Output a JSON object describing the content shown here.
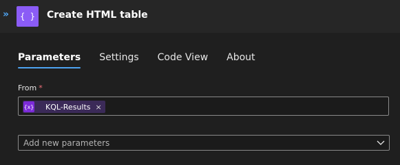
{
  "header": {
    "expand_glyph": "»",
    "app_icon_glyph": "{ }",
    "title": "Create HTML table"
  },
  "tabs": [
    {
      "label": "Parameters",
      "active": true
    },
    {
      "label": "Settings",
      "active": false
    },
    {
      "label": "Code View",
      "active": false
    },
    {
      "label": "About",
      "active": false
    }
  ],
  "from_field": {
    "label": "From",
    "required_mark": "*",
    "token": {
      "icon_glyph": "{x}",
      "label": "KQL-Results",
      "remove_glyph": "×"
    }
  },
  "add_parameters": {
    "label": "Add new parameters"
  },
  "colors": {
    "accent": "#4ea4f2",
    "app_icon": "#8b5cf6",
    "token_icon": "#7c2bd9",
    "required": "#f1707b"
  }
}
